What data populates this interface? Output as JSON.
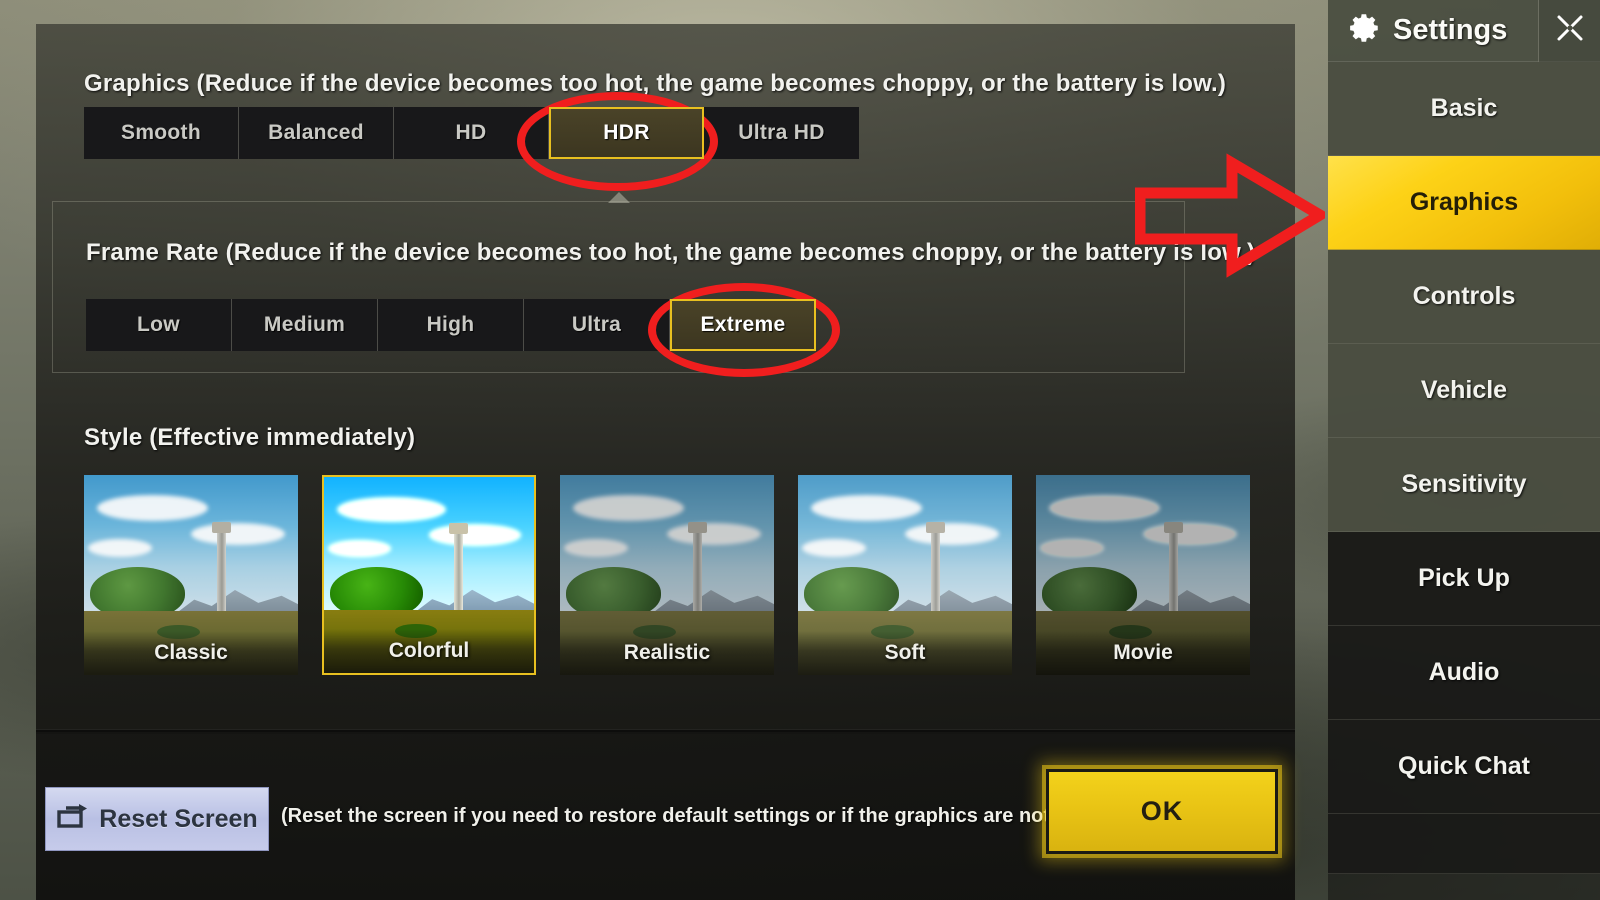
{
  "app": {
    "title": "Settings"
  },
  "sections": {
    "graphics": {
      "label": "Graphics (Reduce if the device becomes too hot, the game becomes choppy, or the battery is low.)",
      "options": [
        "Smooth",
        "Balanced",
        "HD",
        "HDR",
        "Ultra HD"
      ],
      "selected": "HDR",
      "selected_index": 3
    },
    "frame_rate": {
      "label": "Frame Rate (Reduce if the device becomes too hot, the game becomes choppy, or the battery is low.)",
      "options": [
        "Low",
        "Medium",
        "High",
        "Ultra",
        "Extreme"
      ],
      "selected": "Extreme",
      "selected_index": 4
    },
    "style": {
      "label": "Style (Effective immediately)",
      "options": [
        "Classic",
        "Colorful",
        "Realistic",
        "Soft",
        "Movie"
      ],
      "selected": "Colorful",
      "selected_index": 1
    }
  },
  "footer": {
    "reset_label": "Reset Screen",
    "reset_icon": "reset-screen-icon",
    "reset_hint": "(Reset the screen if you need to restore default settings or if the graphics are not ideal)",
    "ok_label": "OK"
  },
  "sidebar": {
    "header": {
      "title": "Settings",
      "gear_icon": "gear-icon",
      "close_icon": "close-icon"
    },
    "items": [
      {
        "label": "Basic",
        "active": false,
        "tone": "light"
      },
      {
        "label": "Graphics",
        "active": true,
        "tone": "light"
      },
      {
        "label": "Controls",
        "active": false,
        "tone": "light"
      },
      {
        "label": "Vehicle",
        "active": false,
        "tone": "light"
      },
      {
        "label": "Sensitivity",
        "active": false,
        "tone": "light"
      },
      {
        "label": "Pick Up",
        "active": false,
        "tone": "dark"
      },
      {
        "label": "Audio",
        "active": false,
        "tone": "dark"
      },
      {
        "label": "Quick Chat",
        "active": false,
        "tone": "dark"
      },
      {
        "label": "",
        "active": false,
        "tone": "dark"
      }
    ]
  },
  "annotations": {
    "color": "#f01e1e",
    "circle_hdr": "highlight-circle-hdr",
    "circle_extreme": "highlight-circle-extreme",
    "arrow_graphics": "highlight-arrow-graphics-tab"
  },
  "colors": {
    "accent_yellow": "#f2c20d",
    "selected_border": "#e8c020",
    "annotation_red": "#f01e1e",
    "panel_dark": "#18181a"
  }
}
